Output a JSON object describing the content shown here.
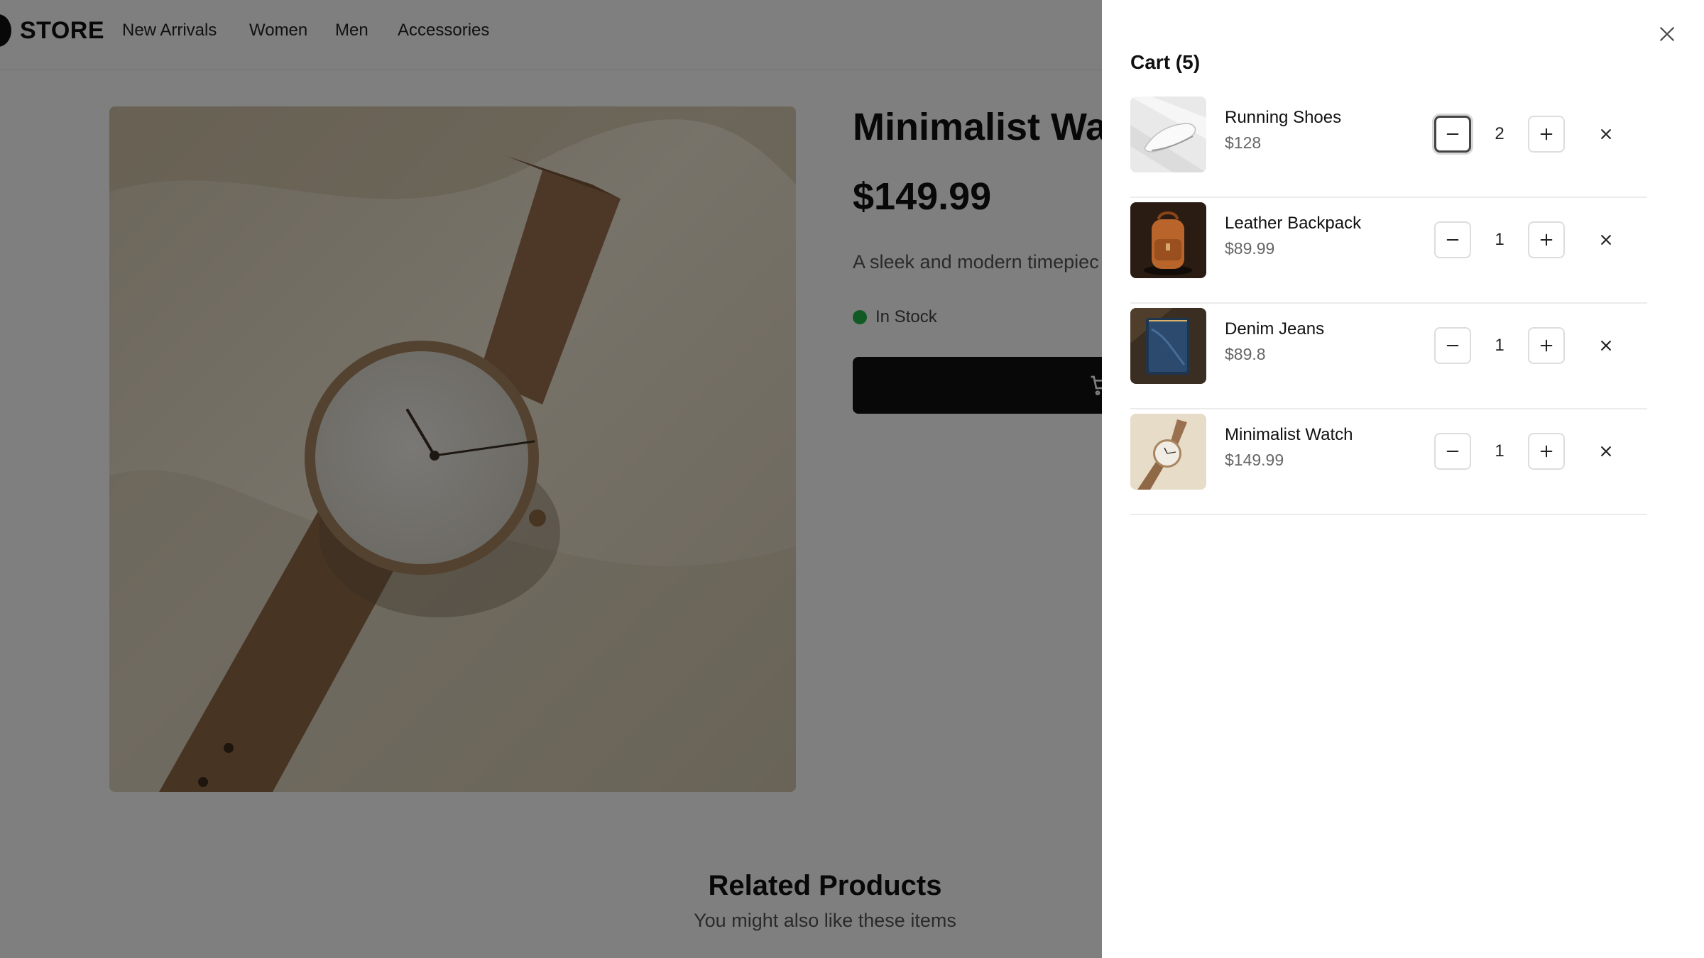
{
  "header": {
    "logo": "STORE",
    "nav": [
      "New Arrivals",
      "Women",
      "Men",
      "Accessories"
    ]
  },
  "product": {
    "title": "Minimalist Watc",
    "price": "$149.99",
    "description": "A sleek and modern timepiec",
    "stock_status": "In Stock",
    "stock_color": "#22b54a"
  },
  "related": {
    "title": "Related Products",
    "subtitle": "You might also like these items"
  },
  "cart": {
    "title": "Cart (5)",
    "items": [
      {
        "name": "Running Shoes",
        "price": "$128",
        "quantity": "2",
        "thumbnail": "running-shoe"
      },
      {
        "name": "Leather Backpack",
        "price": "$89.99",
        "quantity": "1",
        "thumbnail": "leather-backpack"
      },
      {
        "name": "Denim Jeans",
        "price": "$89.8",
        "quantity": "1",
        "thumbnail": "denim-jeans"
      },
      {
        "name": "Minimalist Watch",
        "price": "$149.99",
        "quantity": "1",
        "thumbnail": "minimalist-watch"
      }
    ],
    "icons": {
      "close": "close-icon",
      "decrease": "minus-icon",
      "increase": "plus-icon",
      "remove": "remove-icon"
    }
  },
  "colors": {
    "accent": "#111111",
    "overlay": "rgba(0,0,0,0.5)"
  }
}
